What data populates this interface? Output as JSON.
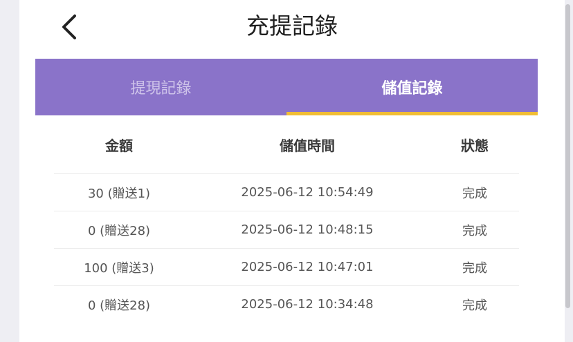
{
  "header": {
    "title": "充提記錄",
    "back_icon": "chevron-left-icon"
  },
  "tabs": [
    {
      "label": "提現記錄",
      "active": false
    },
    {
      "label": "儲值記錄",
      "active": true
    }
  ],
  "colors": {
    "tab_bar": "#8a73c9",
    "tab_active_underline": "#f0bd35"
  },
  "table": {
    "columns": [
      "金額",
      "儲值時間",
      "狀態"
    ],
    "rows": [
      {
        "amount": "30 (贈送1)",
        "time": "2025-06-12 10:54:49",
        "status": "完成"
      },
      {
        "amount": "0 (贈送28)",
        "time": "2025-06-12 10:48:15",
        "status": "完成"
      },
      {
        "amount": "100 (贈送3)",
        "time": "2025-06-12 10:47:01",
        "status": "完成"
      },
      {
        "amount": "0 (贈送28)",
        "time": "2025-06-12 10:34:48",
        "status": "完成"
      }
    ]
  }
}
